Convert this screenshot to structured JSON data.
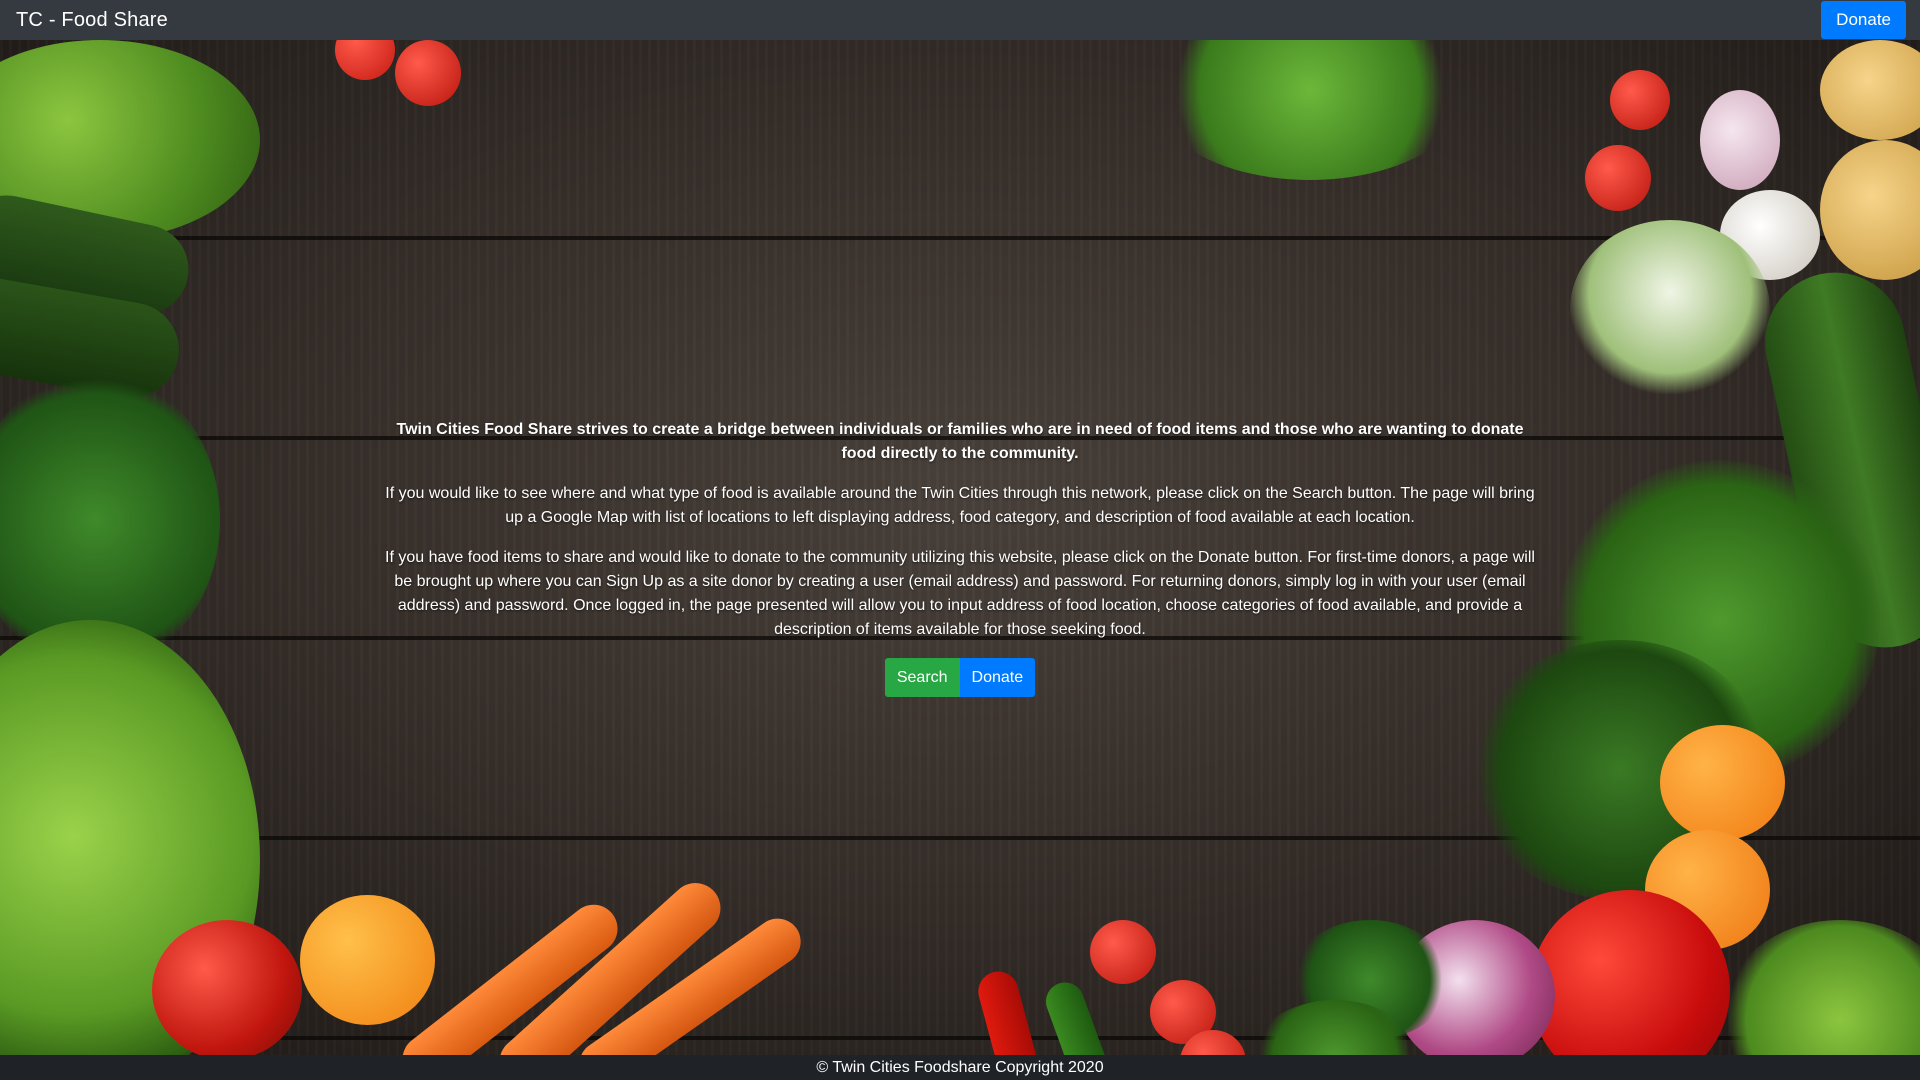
{
  "navbar": {
    "brand": "TC - Food Share",
    "donate_label": "Donate"
  },
  "main": {
    "lead": "Twin Cities Food Share strives to create a bridge between individuals or families who are in need of food items and those who are wanting to donate food directly to the community.",
    "paragraph_search": "If you would like to see where and what type of food is available around the Twin Cities through this network, please click on the Search button. The page will bring up a Google Map with list of locations to left displaying address, food category, and description of food available at each location.",
    "paragraph_donate": "If you have food items to share and would like to donate to the community utilizing this website, please click on the Donate button. For first-time donors, a page will be brought up where you can Sign Up as a site donor by creating a user (email address) and password. For returning donors, simply log in with your user (email address) and password. Once logged in, the page presented will allow you to input address of food location, choose categories of food available, and provide a description of items available for those seeking food.",
    "search_label": "Search",
    "donate_label": "Donate"
  },
  "footer": {
    "copyright": "© Twin Cities Foodshare Copyright 2020"
  },
  "colors": {
    "navbar_bg": "#343a40",
    "primary": "#007bff",
    "success": "#28a745",
    "footer_bg": "#1f2327"
  }
}
